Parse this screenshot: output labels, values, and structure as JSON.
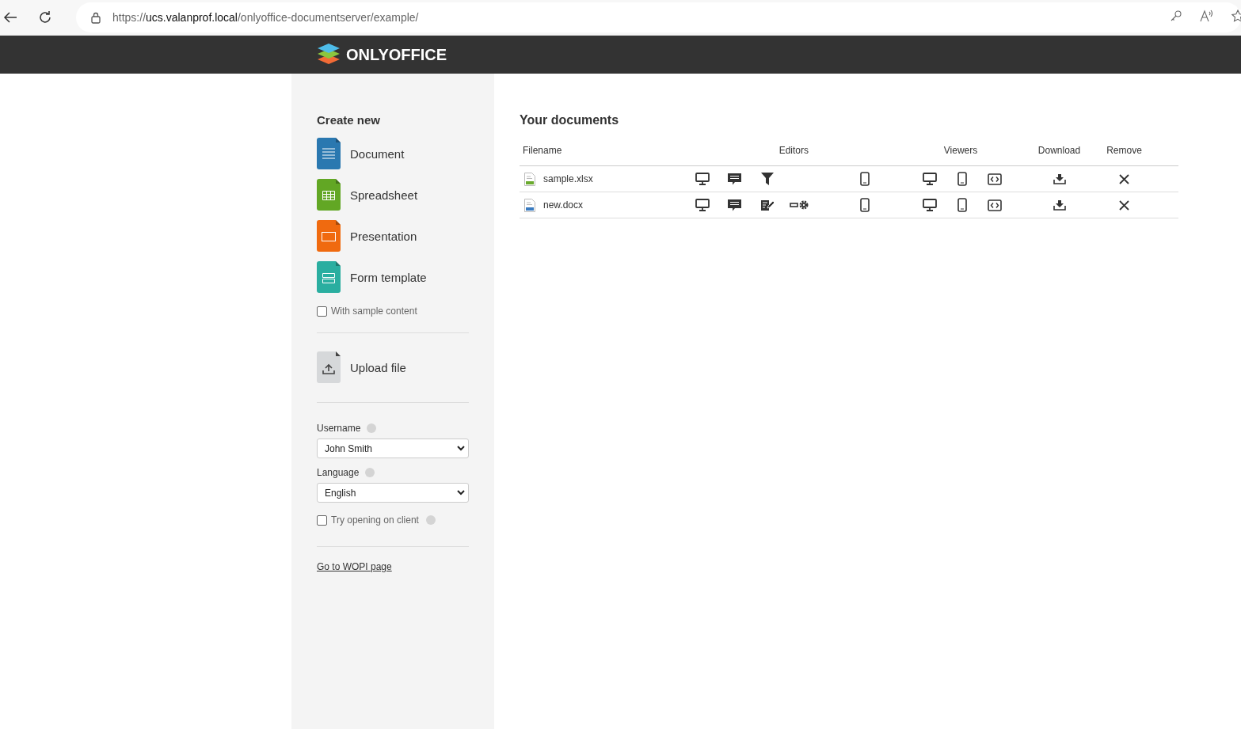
{
  "browser": {
    "url_scheme": "https://",
    "url_host": "ucs.valanprof.local",
    "url_path": "/onlyoffice-documentserver/example/"
  },
  "header": {
    "brand": "ONLYOFFICE"
  },
  "sidebar": {
    "create_title": "Create new",
    "create_items": [
      {
        "kind": "document",
        "label": "Document"
      },
      {
        "kind": "spreadsheet",
        "label": "Spreadsheet"
      },
      {
        "kind": "presentation",
        "label": "Presentation"
      },
      {
        "kind": "form",
        "label": "Form template"
      }
    ],
    "sample_content": {
      "label": "With sample content",
      "checked": false
    },
    "upload": {
      "label": "Upload file"
    },
    "username": {
      "label": "Username",
      "value": "John Smith"
    },
    "language": {
      "label": "Language",
      "value": "English"
    },
    "try_client": {
      "label": "Try opening on client",
      "checked": false
    },
    "wopi_link": "Go to WOPI page"
  },
  "documents": {
    "title": "Your documents",
    "columns": [
      "Filename",
      "Editors",
      "Viewers",
      "Download",
      "Remove"
    ],
    "rows": [
      {
        "name": "sample.xlsx",
        "color": "#6aaa2e",
        "editors": [
          {
            "kind": "desktop"
          },
          {
            "kind": "comment"
          },
          {
            "kind": "filter"
          },
          {
            "kind": "mobile"
          }
        ],
        "viewers": [
          {
            "kind": "desktop"
          },
          {
            "kind": "mobile"
          },
          {
            "kind": "embedded"
          }
        ]
      },
      {
        "name": "new.docx",
        "color": "#3a7bc0",
        "editors": [
          {
            "kind": "desktop"
          },
          {
            "kind": "comment"
          },
          {
            "kind": "review"
          },
          {
            "kind": "settings"
          },
          {
            "kind": "mobile"
          }
        ],
        "viewers": [
          {
            "kind": "desktop"
          },
          {
            "kind": "mobile"
          },
          {
            "kind": "embedded"
          }
        ]
      }
    ]
  }
}
